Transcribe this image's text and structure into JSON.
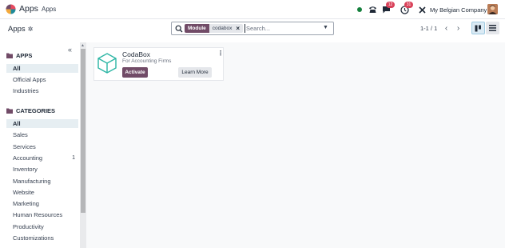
{
  "navbar": {
    "app_name": "Apps",
    "menu_item": "Apps",
    "activity_badge": "12",
    "messages_badge": "31",
    "company": "My Belgian Company"
  },
  "control_panel": {
    "breadcrumb": "Apps",
    "facet_label": "Module",
    "facet_value": "codabox",
    "search_placeholder": "Search...",
    "pager": "1-1 / 1"
  },
  "sidebar": {
    "apps_title": "APPS",
    "apps_items": [
      {
        "label": "All"
      },
      {
        "label": "Official Apps"
      },
      {
        "label": "Industries"
      }
    ],
    "categories_title": "CATEGORIES",
    "category_items": [
      {
        "label": "All",
        "count": ""
      },
      {
        "label": "Sales",
        "count": ""
      },
      {
        "label": "Services",
        "count": ""
      },
      {
        "label": "Accounting",
        "count": "1"
      },
      {
        "label": "Inventory",
        "count": ""
      },
      {
        "label": "Manufacturing",
        "count": ""
      },
      {
        "label": "Website",
        "count": ""
      },
      {
        "label": "Marketing",
        "count": ""
      },
      {
        "label": "Human Resources",
        "count": ""
      },
      {
        "label": "Productivity",
        "count": ""
      },
      {
        "label": "Customizations",
        "count": ""
      }
    ]
  },
  "card": {
    "title": "CodaBox",
    "subtitle": "For Accounting Firms",
    "activate_label": "Activate",
    "learn_more_label": "Learn More"
  },
  "colors": {
    "brand": "#714b67",
    "status_online": "#15803d",
    "badge": "#d9425a",
    "module_icon": "#2bb5a4"
  }
}
